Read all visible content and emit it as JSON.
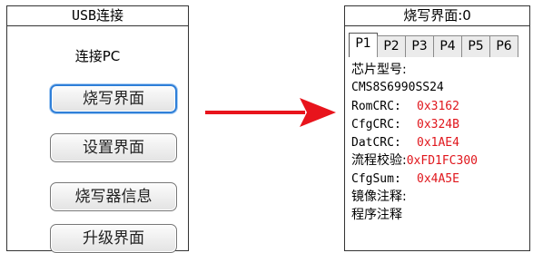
{
  "left_panel": {
    "title": "USB连接",
    "connect_label": "连接PC",
    "buttons": [
      {
        "label": "烧写界面",
        "active": true
      },
      {
        "label": "设置界面",
        "active": false
      },
      {
        "label": "烧写器信息",
        "active": false
      },
      {
        "label": "升级界面",
        "active": false
      }
    ]
  },
  "right_panel": {
    "title": "烧写界面:0",
    "tabs": [
      "P1",
      "P2",
      "P3",
      "P4",
      "P5",
      "P6"
    ],
    "active_tab": "P1",
    "chip_model_label": "芯片型号:",
    "chip_model_value": "CMS8S6990SS24",
    "rom_crc": {
      "label": "RomCRC:",
      "value": "0x3162"
    },
    "cfg_crc": {
      "label": "CfgCRC:",
      "value": "0x324B"
    },
    "dat_crc": {
      "label": "DatCRC:",
      "value": "0x1AE4"
    },
    "flow_check": {
      "label": "流程校验:",
      "value": "0xFD1FC300"
    },
    "cfg_sum": {
      "label": "CfgSum:",
      "value": "0x4A5E"
    },
    "image_note_label": "镜像注释:",
    "program_note_label": "程序注释"
  },
  "colors": {
    "value_red": "#e0161c",
    "arrow_red": "#e8141c",
    "active_button_border": "#2f7fd8"
  }
}
